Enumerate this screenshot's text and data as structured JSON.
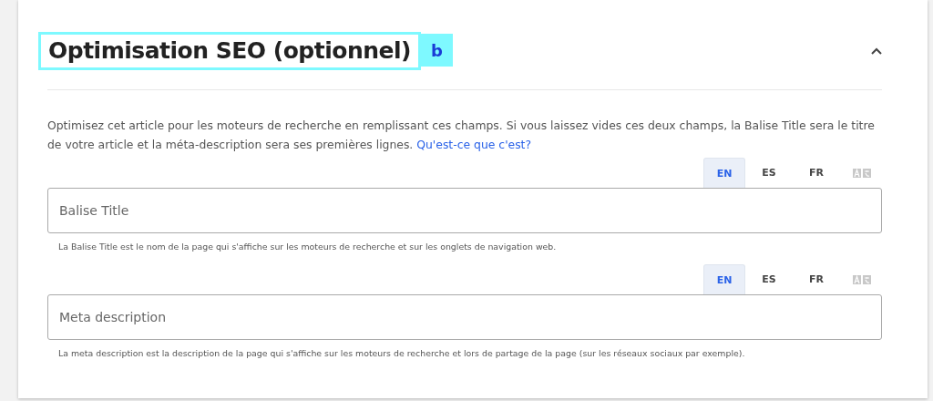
{
  "section": {
    "title": "Optimisation SEO (optionnel)",
    "annotation": "b",
    "expanded": true
  },
  "intro": {
    "text": "Optimisez cet article pour les moteurs de recherche en remplissant ces champs. Si vous laissez vides ces deux champs, la Balise Title sera le titre de votre article et la méta-description sera ses premières lignes.",
    "link": "Qu'est-ce que c'est?"
  },
  "fields": [
    {
      "placeholder": "Balise Title",
      "help": "La Balise Title est le nom de la page qui s'affiche sur les moteurs de recherche et sur les onglets de navigation web.",
      "languages": [
        {
          "label": "EN",
          "selected": true
        },
        {
          "label": "ES",
          "selected": false
        },
        {
          "label": "FR",
          "selected": false
        }
      ]
    },
    {
      "placeholder": "Meta description",
      "help": "La meta description est la description de la page qui s'affiche sur les moteurs de recherche et lors de partage de la page (sur les réseaux sociaux par exemple).",
      "languages": [
        {
          "label": "EN",
          "selected": true
        },
        {
          "label": "ES",
          "selected": false
        },
        {
          "label": "FR",
          "selected": false
        }
      ]
    }
  ]
}
